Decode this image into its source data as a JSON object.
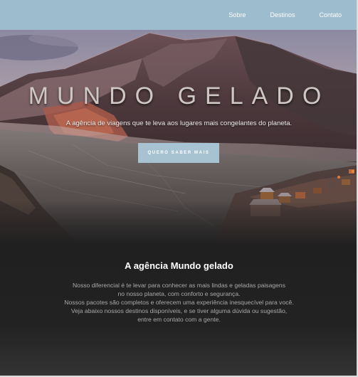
{
  "colors": {
    "header_bg": "#9dbccd",
    "button_bg": "#a7c3d2",
    "section_bg": "#202020",
    "title_text": "#cfc7c3"
  },
  "nav": {
    "items": [
      {
        "label": "Sobre"
      },
      {
        "label": "Destinos"
      },
      {
        "label": "Contato"
      }
    ]
  },
  "hero": {
    "title": "MUNDO GELADO",
    "subtitle": "A agência de viagens que te leva aos lugares mais congelantes do planeta.",
    "cta_label": "QUERO SABER MAIS",
    "image_icon": "frozen-lake-landscape"
  },
  "about": {
    "heading": "A agência Mundo gelado",
    "lines": [
      "Nosso diferencial é te levar para conhecer as mais lindas e geladas paisagens",
      "no nosso planeta, com conforto e segurança.",
      "Nossos pacotes são completos e oferecem uma experiência inesquecível para você.",
      "Veja abaixo nossos destinos disponíveis, e se tiver alguma dúvida ou sugestão,",
      "entre em contato com a gente."
    ]
  }
}
